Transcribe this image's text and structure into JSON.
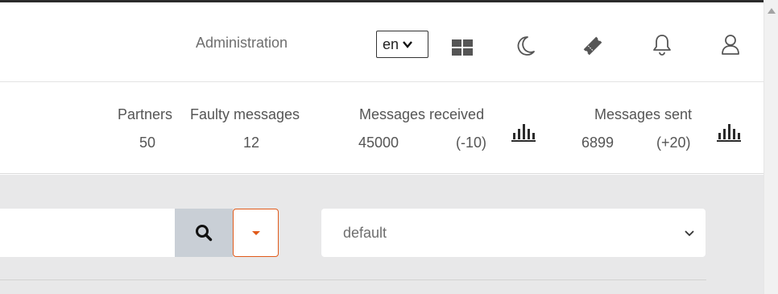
{
  "header": {
    "administration_label": "Administration",
    "language": {
      "selected": "en"
    },
    "icons": [
      "apps-icon",
      "moon-icon",
      "ticket-icon",
      "bell-icon",
      "user-icon"
    ]
  },
  "stats": {
    "partners": {
      "label": "Partners",
      "value": "50"
    },
    "faulty": {
      "label": "Faulty messages",
      "value": "12"
    },
    "received": {
      "label": "Messages received",
      "value": "45000",
      "delta": "(-10)"
    },
    "sent": {
      "label": "Messages sent",
      "value": "6899",
      "delta": "(+20)"
    }
  },
  "search": {
    "value": "",
    "placeholder": ""
  },
  "profile_select": {
    "selected": "default"
  },
  "colors": {
    "accent": "#e05a1a",
    "chart_icon": "#2b2b2b",
    "content_bg": "#e8e8e9",
    "search_button_bg": "#c9cfd6"
  }
}
